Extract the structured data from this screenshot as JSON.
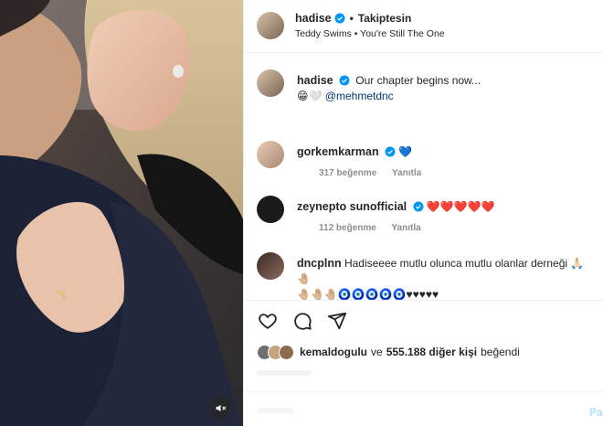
{
  "header": {
    "username": "hadise",
    "follow_status": "Takiptesin",
    "dot": "•",
    "audio": "Teddy Swims • You're Still The One"
  },
  "caption": {
    "username": "hadise",
    "text": "Our chapter begins now...",
    "emoji_line": "😁🤍",
    "mention": "@mehmetdnc"
  },
  "comments": [
    {
      "username": "gorkemkarman",
      "text": "💙",
      "likes": "317 beğenme",
      "reply": "Yanıtla"
    },
    {
      "username": "zeynepto sunofficial",
      "display": "zeynepto sunofficial",
      "text": "❤️❤️❤️❤️❤️",
      "likes": "112 beğenme",
      "reply": "Yanıtla"
    },
    {
      "username": "dncplnn",
      "text": "Hadiseeee mutlu olunca mutlu olanlar derneği 🙏🏻🤚🏼",
      "text2": "🤚🏼🤚🏼🤚🏼🧿🧿🧿🧿🧿♥♥♥♥♥"
    }
  ],
  "likes": {
    "liker": "kemaldogulu",
    "joiner": "ve",
    "count": "555.188 diğer kişi",
    "suffix": "beğendi"
  },
  "post_label": "Pa",
  "colors": {
    "accent": "#0095f6",
    "verified": "#0095f6",
    "heart_red": "#ed4956",
    "text": "#262626",
    "muted": "#8e8e8e"
  },
  "icons": [
    "verified-icon",
    "heart-icon",
    "comment-icon",
    "share-icon",
    "mute-icon"
  ]
}
